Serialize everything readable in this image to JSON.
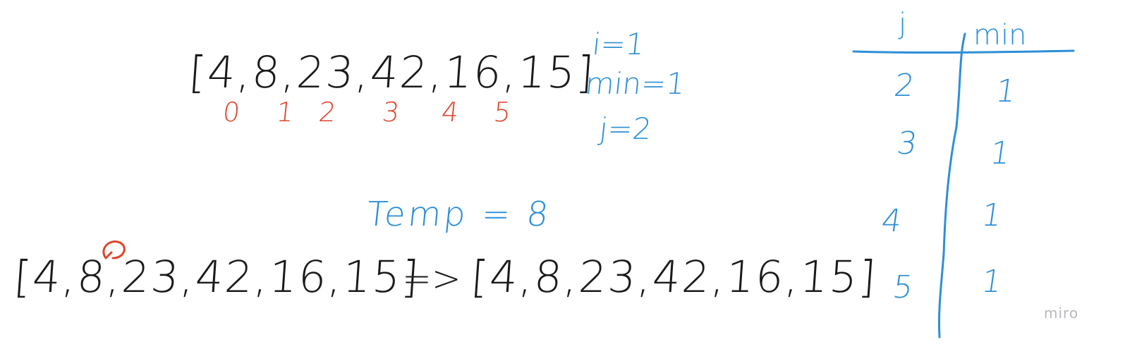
{
  "board": {
    "top_array": "[4,8,23,42,16,15]",
    "indices": [
      "0",
      "1",
      "2",
      "3",
      "4",
      "5"
    ],
    "vars": {
      "i": "i=1",
      "min": "min=1",
      "j": "j=2"
    },
    "temp": "Temp = 8",
    "bottom_array_before": "[4,8,23,42,16,15]",
    "arrow": "=>",
    "bottom_array_after": "[4,8,23,42,16,15]",
    "table": {
      "headers": [
        "j",
        "min"
      ],
      "rows": [
        {
          "j": "2",
          "min": "1"
        },
        {
          "j": "3",
          "min": "1"
        },
        {
          "j": "4",
          "min": "1"
        },
        {
          "j": "5",
          "min": "1"
        }
      ]
    }
  },
  "branding": {
    "logo_text": "miro"
  },
  "colors": {
    "ink_black": "#1a1a1a",
    "ink_blue": "#2d8fd8",
    "ink_red": "#e0442b",
    "logo_gray": "#b8b8bd"
  }
}
